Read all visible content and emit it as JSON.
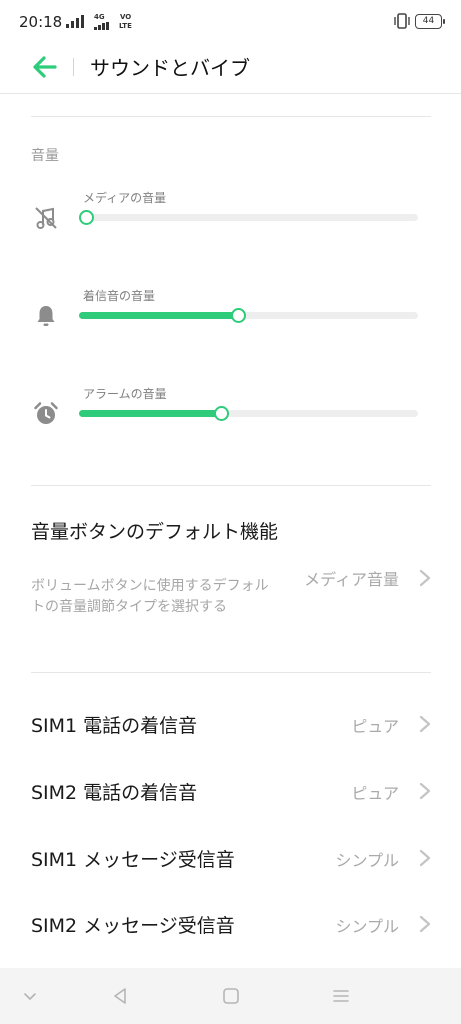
{
  "status_bar": {
    "time": "20:18",
    "network_badge_1": "4G",
    "network_badge_2": "VO",
    "network_badge_3": "LTE",
    "battery": "44"
  },
  "app_bar": {
    "title": "サウンドとバイブ",
    "back_icon": "back-arrow-icon",
    "accent_color": "#2ecc7a"
  },
  "volume_section": {
    "header": "音量",
    "sliders": [
      {
        "label": "メディアの音量",
        "icon": "music-muted-icon",
        "level": 0.0
      },
      {
        "label": "着信音の音量",
        "icon": "bell-icon",
        "level": 0.47
      },
      {
        "label": "アラームの音量",
        "icon": "alarm-clock-icon",
        "level": 0.42
      }
    ]
  },
  "default_function": {
    "title": "音量ボタンのデフォルト機能",
    "description": "ボリュームボタンに使用するデフォルトの音量調節タイプを選択する",
    "value": "メディア音量"
  },
  "ringtones": [
    {
      "title": "SIM1 電話の着信音",
      "value": "ピュア"
    },
    {
      "title": "SIM2 電話の着信音",
      "value": "ピュア"
    },
    {
      "title": "SIM1 メッセージ受信音",
      "value": "シンプル"
    },
    {
      "title": "SIM2 メッセージ受信音",
      "value": "シンプル"
    }
  ],
  "nav_bar": {
    "icons": [
      "collapse-icon",
      "back-icon",
      "home-icon",
      "menu-icon"
    ]
  }
}
